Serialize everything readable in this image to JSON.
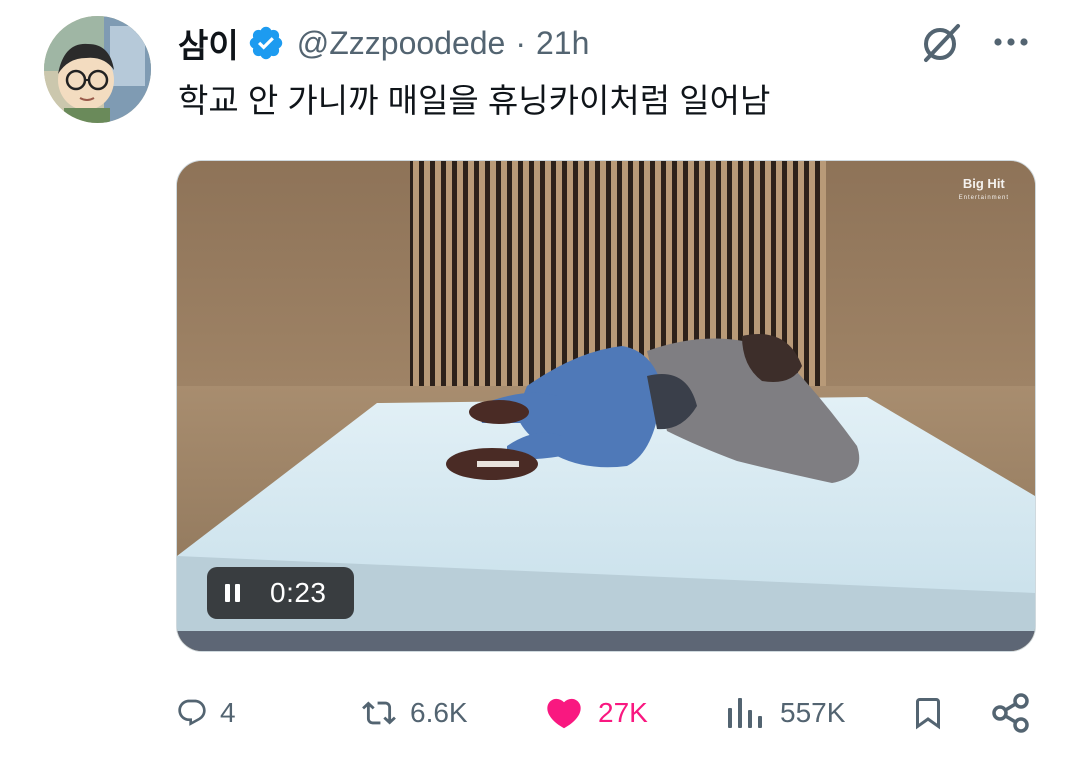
{
  "tweet": {
    "author_name": "삼이",
    "handle": "@Zzzpoodede",
    "separator": "·",
    "time": "21h",
    "text": "학교 안 가니까 매일을 휴닝카이처럼 일어남",
    "verified": true
  },
  "media": {
    "watermark_line1": "Big Hit",
    "watermark_line2": "Entertainment",
    "player_state": "playing",
    "timestamp": "0:23"
  },
  "actions": {
    "replies": "4",
    "reposts": "6.6K",
    "likes": "27K",
    "views": "557K",
    "liked": true
  },
  "colors": {
    "verified_blue": "#1d9bf0",
    "like_pink": "#f91880",
    "muted": "#536471"
  },
  "icons": {
    "reply": "reply-bubble-icon",
    "repost": "repost-icon",
    "like": "heart-filled-icon",
    "views": "bar-chart-icon",
    "bookmark": "bookmark-icon",
    "share": "share-icon",
    "grok": "grok-slash-icon",
    "more": "more-dots-icon",
    "pause": "pause-icon"
  }
}
